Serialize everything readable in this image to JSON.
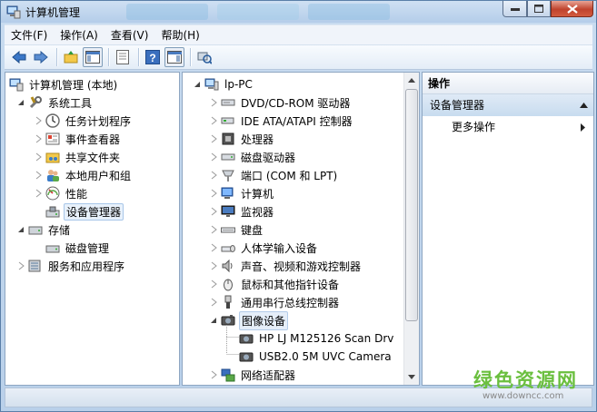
{
  "window": {
    "title": "计算机管理"
  },
  "menu": [
    "文件(F)",
    "操作(A)",
    "查看(V)",
    "帮助(H)"
  ],
  "left_tree": [
    {
      "label": "计算机管理 (本地)",
      "icon": "computer-mgmt-icon"
    },
    {
      "label": "系统工具",
      "icon": "tools-icon"
    },
    {
      "label": "任务计划程序",
      "icon": "clock-icon"
    },
    {
      "label": "事件查看器",
      "icon": "event-viewer-icon"
    },
    {
      "label": "共享文件夹",
      "icon": "shared-folder-icon"
    },
    {
      "label": "本地用户和组",
      "icon": "users-icon"
    },
    {
      "label": "性能",
      "icon": "performance-icon"
    },
    {
      "label": "设备管理器",
      "icon": "device-manager-icon"
    },
    {
      "label": "存储",
      "icon": "storage-icon"
    },
    {
      "label": "磁盘管理",
      "icon": "disk-mgmt-icon"
    },
    {
      "label": "服务和应用程序",
      "icon": "services-icon"
    }
  ],
  "device_tree": [
    {
      "label": "lp-PC",
      "icon": "computer-icon"
    },
    {
      "label": "DVD/CD-ROM 驱动器",
      "icon": "dvd-icon"
    },
    {
      "label": "IDE ATA/ATAPI 控制器",
      "icon": "ide-icon"
    },
    {
      "label": "处理器",
      "icon": "cpu-icon"
    },
    {
      "label": "磁盘驱动器",
      "icon": "disk-icon"
    },
    {
      "label": "端口 (COM 和 LPT)",
      "icon": "port-icon"
    },
    {
      "label": "计算机",
      "icon": "computer-icon"
    },
    {
      "label": "监视器",
      "icon": "monitor-icon"
    },
    {
      "label": "键盘",
      "icon": "keyboard-icon"
    },
    {
      "label": "人体学输入设备",
      "icon": "hid-icon"
    },
    {
      "label": "声音、视频和游戏控制器",
      "icon": "sound-icon"
    },
    {
      "label": "鼠标和其他指针设备",
      "icon": "mouse-icon"
    },
    {
      "label": "通用串行总线控制器",
      "icon": "usb-icon"
    },
    {
      "label": "图像设备",
      "icon": "camera-icon"
    },
    {
      "label": "HP LJ M125126 Scan Drv",
      "icon": "camera-icon"
    },
    {
      "label": "USB2.0 5M UVC Camera",
      "icon": "camera-icon"
    },
    {
      "label": "网络适配器",
      "icon": "network-icon"
    }
  ],
  "actions": {
    "header": "操作",
    "section": "设备管理器",
    "more": "更多操作"
  },
  "watermark": {
    "title": "绿色资源网",
    "url": "www.downcc.com"
  },
  "colors": {
    "accent": "#6abf3e",
    "selection": "#e8f1fb",
    "pane_border": "#8ea6c2"
  }
}
